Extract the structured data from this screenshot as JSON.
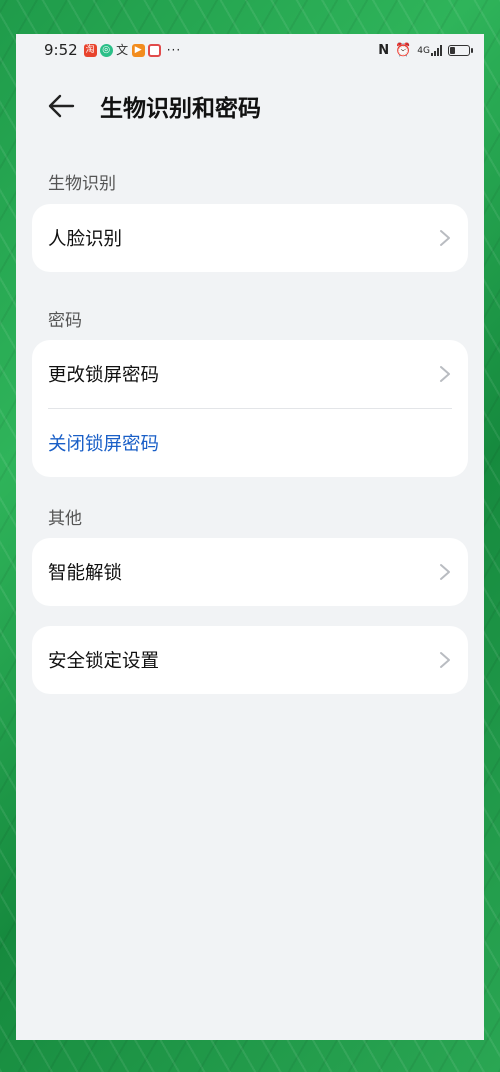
{
  "status_bar": {
    "time": "9:52",
    "app_icons": [
      "taobao-icon",
      "green-app-icon",
      "translate-icon",
      "play-icon",
      "red-app-icon"
    ],
    "more": "···",
    "nfc": "N",
    "alarm": "⏰",
    "network": "4G",
    "battery_level": 0.3
  },
  "header": {
    "title": "生物识别和密码"
  },
  "sections": {
    "biometrics": {
      "label": "生物识别",
      "items": [
        {
          "label": "人脸识别"
        }
      ]
    },
    "password": {
      "label": "密码",
      "items": [
        {
          "label": "更改锁屏密码"
        },
        {
          "label": "关闭锁屏密码"
        }
      ]
    },
    "other": {
      "label": "其他",
      "items": [
        {
          "label": "智能解锁"
        },
        {
          "label": "安全锁定设置"
        }
      ]
    }
  },
  "colors": {
    "accent_link": "#1a5fc7",
    "background": "#f1f3f5",
    "card": "#ffffff"
  }
}
